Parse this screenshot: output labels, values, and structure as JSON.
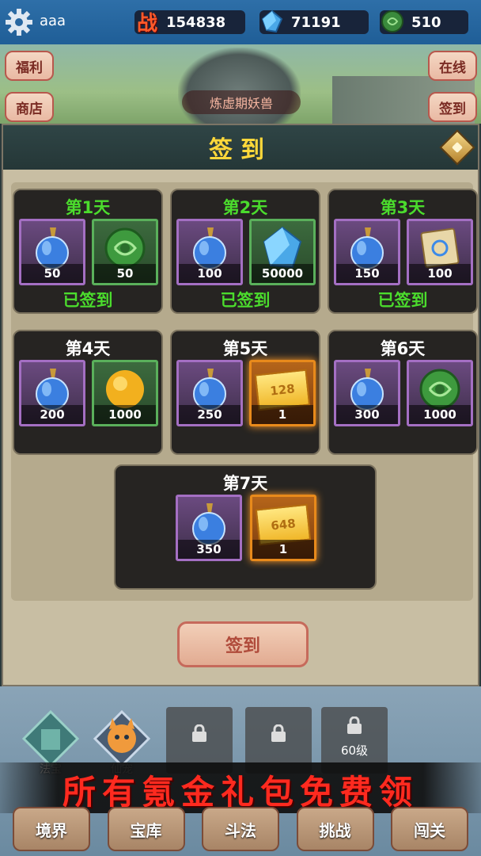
{
  "user": {
    "name": "aaa"
  },
  "resources": [
    {
      "icon": "battle-power-icon",
      "glyph": "战",
      "value": "154838"
    },
    {
      "icon": "crystal-icon",
      "value": "71191"
    },
    {
      "icon": "jade-icon",
      "value": "510"
    }
  ],
  "side_buttons": {
    "welfare": "福利",
    "shop": "商店",
    "online": "在线",
    "checkin": "签到"
  },
  "scene_label": "炼虚期妖兽",
  "panel": {
    "title": "签到",
    "days": [
      {
        "label": "第1天",
        "status": "已签到",
        "items": [
          {
            "icon": "potion-icon",
            "qty": "50"
          },
          {
            "icon": "jade-icon",
            "qty": "50"
          }
        ]
      },
      {
        "label": "第2天",
        "status": "已签到",
        "items": [
          {
            "icon": "potion-icon",
            "qty": "100"
          },
          {
            "icon": "crystal-icon",
            "qty": "50000"
          }
        ]
      },
      {
        "label": "第3天",
        "status": "已签到",
        "items": [
          {
            "icon": "potion-icon",
            "qty": "150"
          },
          {
            "icon": "scroll-icon",
            "qty": "100"
          }
        ]
      },
      {
        "label": "第4天",
        "status": "",
        "items": [
          {
            "icon": "potion-icon",
            "qty": "200"
          },
          {
            "icon": "gold-orb-icon",
            "qty": "1000"
          }
        ]
      },
      {
        "label": "第5天",
        "status": "",
        "items": [
          {
            "icon": "potion-icon",
            "qty": "250"
          },
          {
            "icon": "ticket-icon",
            "ticket": "128",
            "qty": "1"
          }
        ]
      },
      {
        "label": "第6天",
        "status": "",
        "items": [
          {
            "icon": "potion-icon",
            "qty": "300"
          },
          {
            "icon": "jade-icon",
            "qty": "1000"
          }
        ]
      },
      {
        "label": "第7天",
        "status": "",
        "items": [
          {
            "icon": "potion-icon",
            "qty": "350"
          },
          {
            "icon": "ticket-icon",
            "ticket": "648",
            "qty": "1"
          }
        ]
      }
    ],
    "button": "签到"
  },
  "features": [
    {
      "label": "法宝",
      "locked": false
    },
    {
      "label": "仙宠",
      "locked": false
    },
    {
      "label": "",
      "locked": true
    },
    {
      "label": "",
      "locked": true
    },
    {
      "label": "60级",
      "locked": true
    }
  ],
  "promo": "所有氪金礼包免费领",
  "nav": [
    "境界",
    "宝库",
    "斗法",
    "挑战",
    "闯关"
  ],
  "colors": {
    "done": "#4bdc2d",
    "title": "#ffd83a",
    "promo": "#ff2a1f"
  }
}
